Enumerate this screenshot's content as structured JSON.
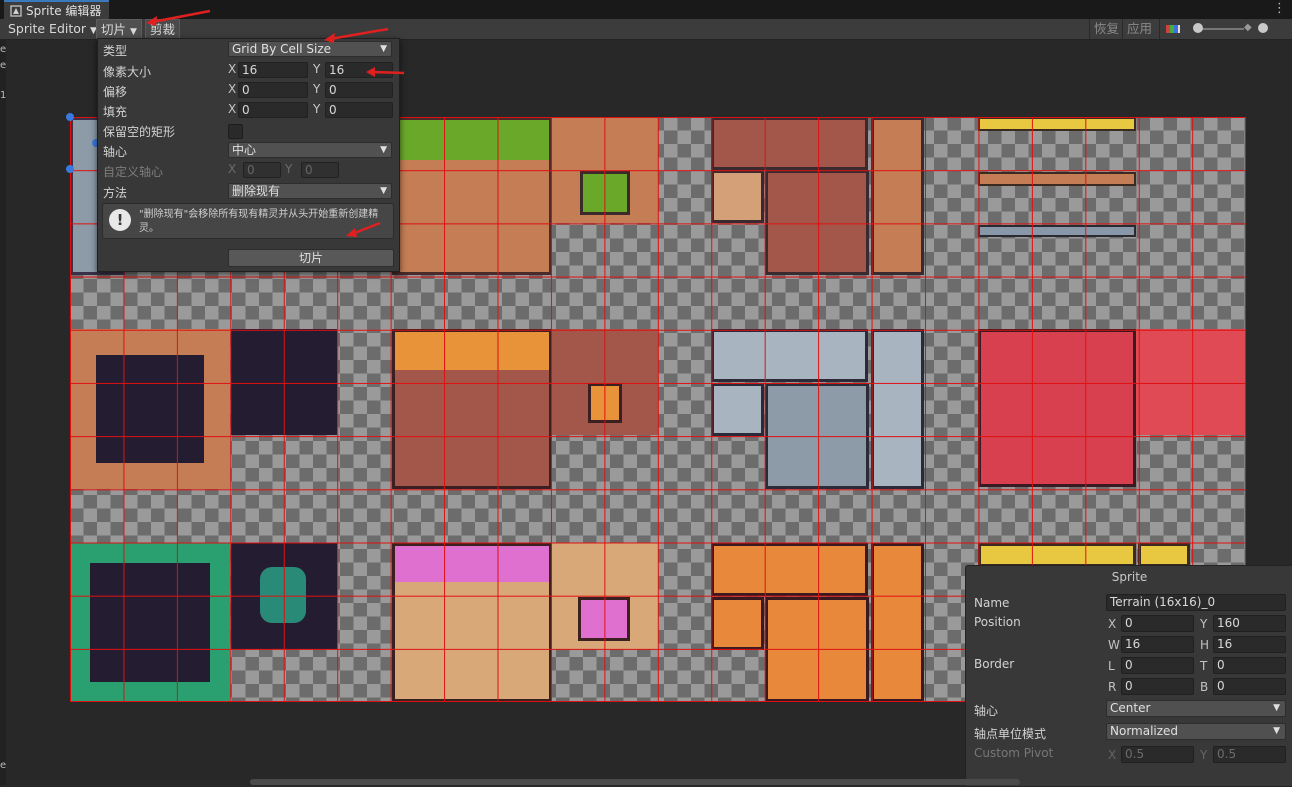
{
  "window": {
    "title": "Sprite 编辑器"
  },
  "toolbar": {
    "editor_mode": "Sprite Editor",
    "slice": "切片",
    "trim": "剪裁",
    "revert": "恢复",
    "apply": "应用"
  },
  "left_edge": {
    "chars": [
      "e",
      "e",
      "1",
      "e"
    ]
  },
  "slice_panel": {
    "type_label": "类型",
    "type_value": "Grid By Cell Size",
    "pixel_size_label": "像素大小",
    "pixel_size": {
      "x_label": "X",
      "x": "16",
      "y_label": "Y",
      "y": "16"
    },
    "offset_label": "偏移",
    "offset": {
      "x_label": "X",
      "x": "0",
      "y_label": "Y",
      "y": "0"
    },
    "padding_label": "填充",
    "padding": {
      "x_label": "X",
      "x": "0",
      "y_label": "Y",
      "y": "0"
    },
    "keep_empty_label": "保留空的矩形",
    "keep_empty_checked": false,
    "pivot_label": "轴心",
    "pivot_value": "中心",
    "custom_pivot_label": "自定义轴心",
    "custom_pivot": {
      "x_label": "X",
      "x": "0",
      "y_label": "Y",
      "y": "0"
    },
    "method_label": "方法",
    "method_value": "删除现有",
    "help_text": "\"删除现有\"会移除所有现有精灵并从头开始重新创建精灵。",
    "slice_button": "切片"
  },
  "sprite_panel": {
    "title": "Sprite",
    "name_label": "Name",
    "name_value": "Terrain (16x16)_0",
    "position_label": "Position",
    "x_label": "X",
    "x": "0",
    "y_label": "Y",
    "y": "160",
    "w_label": "W",
    "w": "16",
    "h_label": "H",
    "h": "16",
    "border_label": "Border",
    "l_label": "L",
    "l": "0",
    "t_label": "T",
    "t": "0",
    "r_label": "R",
    "r": "0",
    "b_label": "B",
    "b": "0",
    "pivot_label": "轴心",
    "pivot_value": "Center",
    "pivot_unit_label": "轴点单位模式",
    "pivot_unit_value": "Normalized",
    "custom_pivot_label": "Custom Pivot",
    "cp_x_label": "X",
    "cp_x": "0.5",
    "cp_y_label": "Y",
    "cp_y": "0.5"
  },
  "colors": {
    "grid": "#e01010",
    "annotation_arrow": "#e02020",
    "accent": "#3a79bb"
  }
}
